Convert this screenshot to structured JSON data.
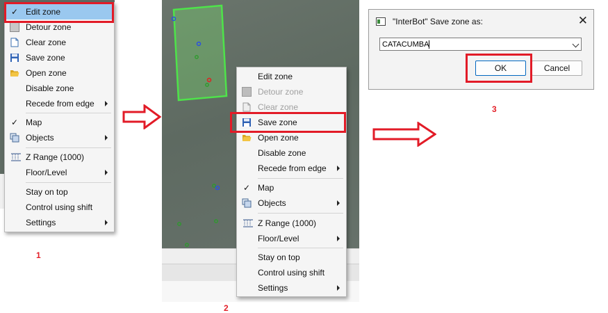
{
  "menu1": {
    "items": [
      {
        "label": "Edit zone",
        "icon": "check-icon",
        "arrow": false,
        "disabled": false
      },
      {
        "label": "Detour zone",
        "icon": "detour-zone-icon",
        "arrow": false,
        "disabled": false
      },
      {
        "label": "Clear zone",
        "icon": "document-icon",
        "arrow": false,
        "disabled": false
      },
      {
        "label": "Save zone",
        "icon": "floppy-disk-icon",
        "arrow": false,
        "disabled": false
      },
      {
        "label": "Open zone",
        "icon": "folder-open-icon",
        "arrow": false,
        "disabled": false
      },
      {
        "label": "Disable zone",
        "icon": "",
        "arrow": false,
        "disabled": false
      },
      {
        "label": "Recede from edge",
        "icon": "",
        "arrow": true,
        "disabled": false
      },
      {
        "label": "Map",
        "icon": "check-icon",
        "arrow": false,
        "disabled": false
      },
      {
        "label": "Objects",
        "icon": "objects-icon",
        "arrow": true,
        "disabled": false
      },
      {
        "label": "Z Range (1000)",
        "icon": "z-range-icon",
        "arrow": false,
        "disabled": false
      },
      {
        "label": "Floor/Level",
        "icon": "",
        "arrow": true,
        "disabled": false
      },
      {
        "label": "Stay on top",
        "icon": "",
        "arrow": false,
        "disabled": false
      },
      {
        "label": "Control using shift",
        "icon": "",
        "arrow": false,
        "disabled": false
      },
      {
        "label": "Settings",
        "icon": "",
        "arrow": true,
        "disabled": false
      }
    ]
  },
  "menu2": {
    "items": [
      {
        "label": "Edit zone",
        "icon": "",
        "arrow": false,
        "disabled": false
      },
      {
        "label": "Detour zone",
        "icon": "detour-zone-icon",
        "arrow": false,
        "disabled": true
      },
      {
        "label": "Clear zone",
        "icon": "document-icon",
        "arrow": false,
        "disabled": true
      },
      {
        "label": "Save zone",
        "icon": "floppy-disk-icon",
        "arrow": false,
        "disabled": false
      },
      {
        "label": "Open zone",
        "icon": "folder-open-icon",
        "arrow": false,
        "disabled": false
      },
      {
        "label": "Disable zone",
        "icon": "",
        "arrow": false,
        "disabled": false
      },
      {
        "label": "Recede from edge",
        "icon": "",
        "arrow": true,
        "disabled": false
      },
      {
        "label": "Map",
        "icon": "check-icon",
        "arrow": false,
        "disabled": false
      },
      {
        "label": "Objects",
        "icon": "objects-icon",
        "arrow": true,
        "disabled": false
      },
      {
        "label": "Z Range (1000)",
        "icon": "z-range-icon",
        "arrow": false,
        "disabled": false
      },
      {
        "label": "Floor/Level",
        "icon": "",
        "arrow": true,
        "disabled": false
      },
      {
        "label": "Stay on top",
        "icon": "",
        "arrow": false,
        "disabled": false
      },
      {
        "label": "Control using shift",
        "icon": "",
        "arrow": false,
        "disabled": false
      },
      {
        "label": "Settings",
        "icon": "",
        "arrow": true,
        "disabled": false
      }
    ]
  },
  "dialog": {
    "title": "\"InterBot\" Save zone as:",
    "input_value": "CATACUMBA",
    "ok_label": "OK",
    "cancel_label": "Cancel"
  },
  "steps": {
    "one": "1",
    "two": "2",
    "three": "3"
  },
  "colors": {
    "annotation_red": "#e21b27",
    "highlight_blue": "#9ac8ef",
    "zone_green": "#4ee34a"
  }
}
